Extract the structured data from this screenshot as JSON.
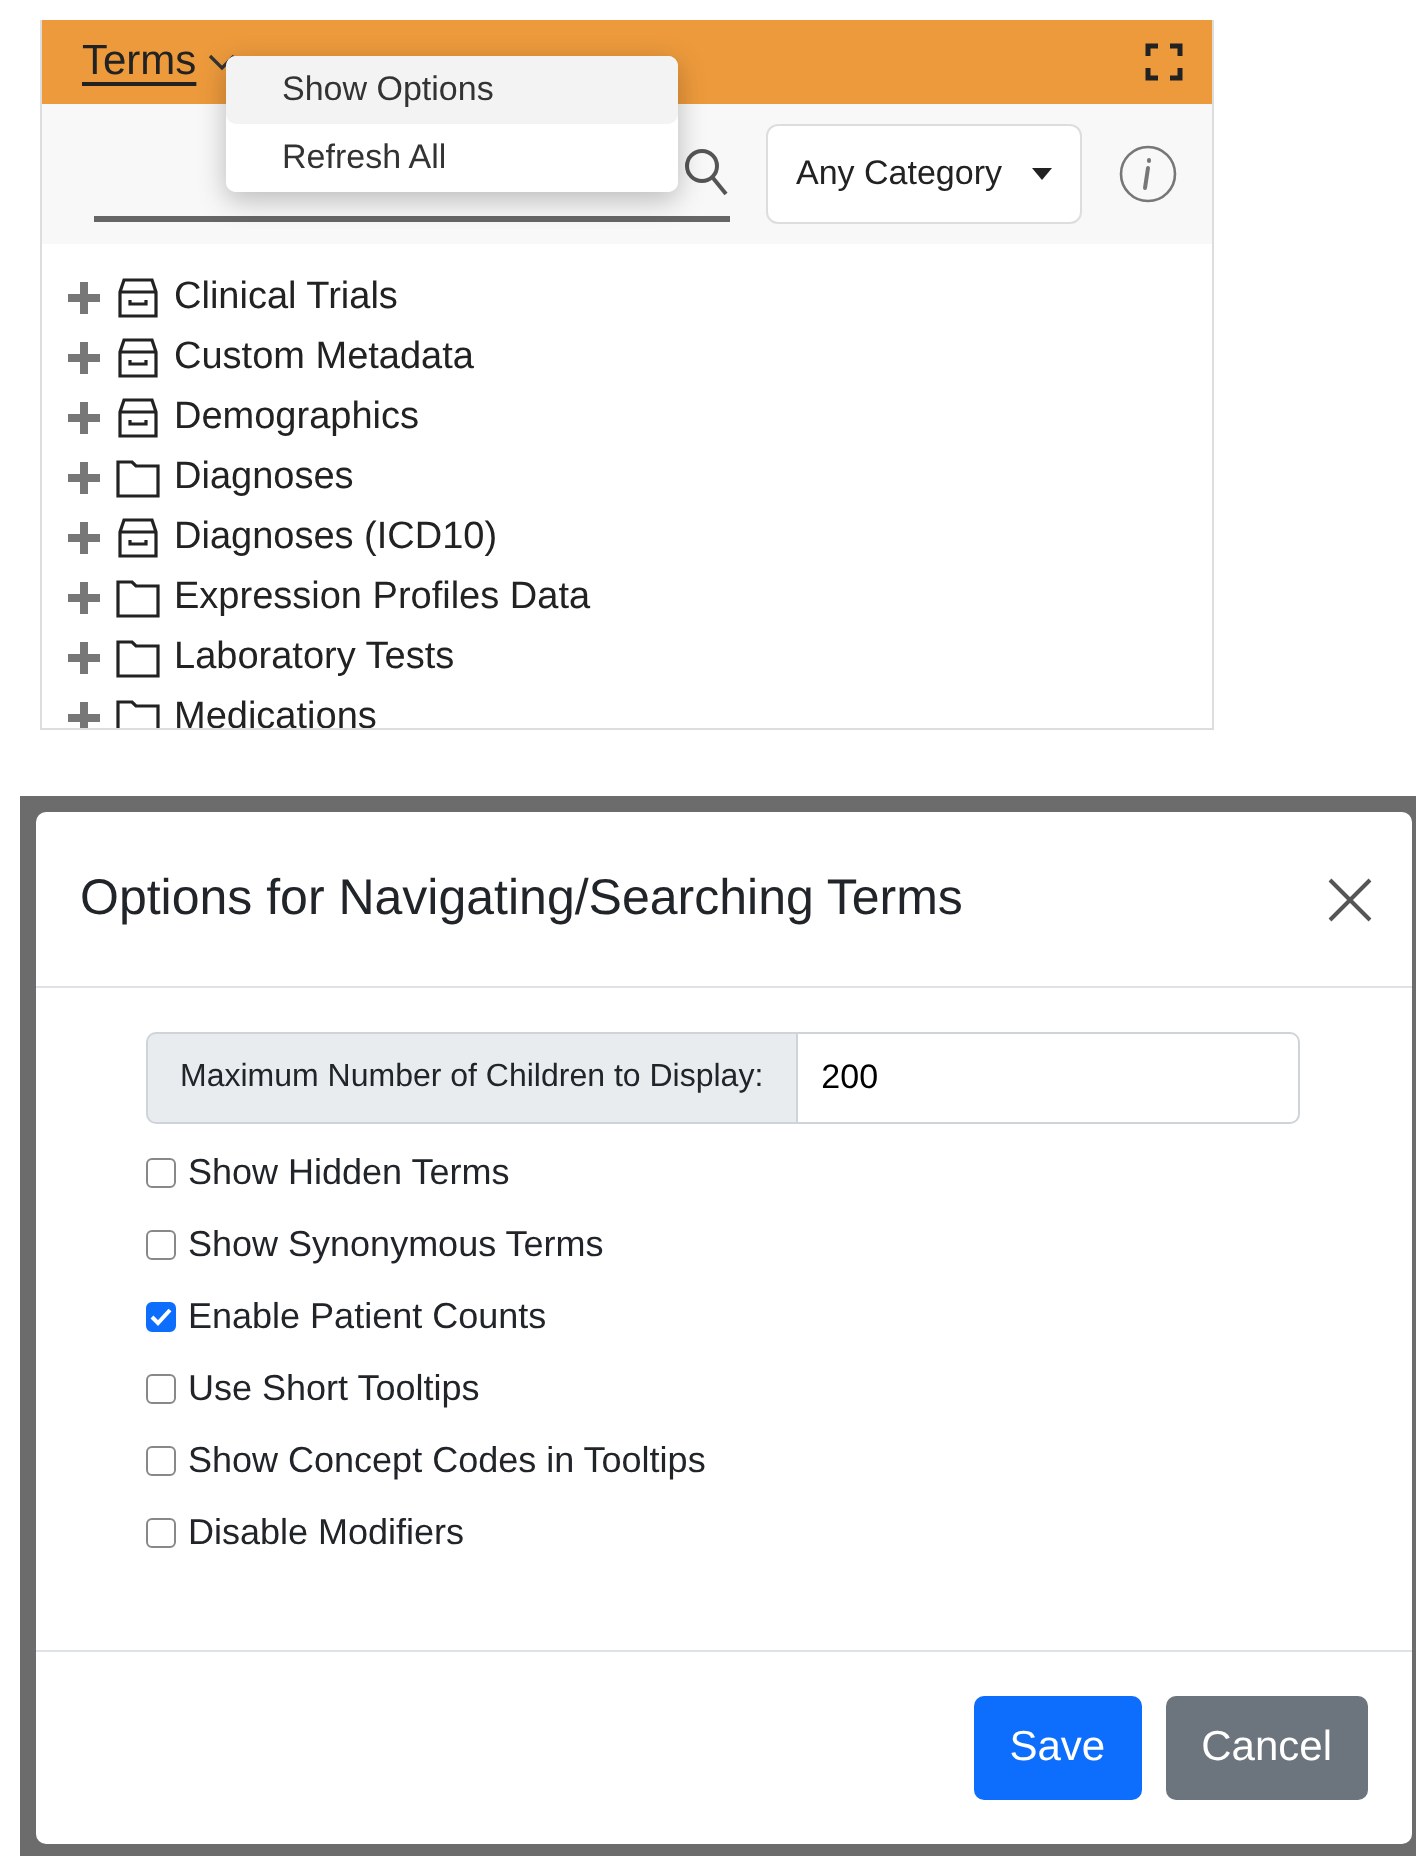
{
  "terms_panel": {
    "title": "Terms",
    "menu": [
      {
        "label": "Show Options",
        "selected": true
      },
      {
        "label": "Refresh All",
        "selected": false
      }
    ],
    "category": "Any Category",
    "tree": [
      {
        "label": "Clinical Trials",
        "kind": "archive"
      },
      {
        "label": "Custom Metadata",
        "kind": "archive"
      },
      {
        "label": "Demographics",
        "kind": "archive"
      },
      {
        "label": "Diagnoses",
        "kind": "folder"
      },
      {
        "label": "Diagnoses (ICD10)",
        "kind": "archive"
      },
      {
        "label": "Expression Profiles Data",
        "kind": "folder"
      },
      {
        "label": "Laboratory Tests",
        "kind": "folder"
      },
      {
        "label": "Medications",
        "kind": "folder"
      }
    ]
  },
  "dialog": {
    "title": "Options for Navigating/Searching Terms",
    "max_children": {
      "label": "Maximum Number of Children to Display:",
      "value": "200"
    },
    "options": [
      {
        "label": "Show Hidden Terms",
        "checked": false
      },
      {
        "label": "Show Synonymous Terms",
        "checked": false
      },
      {
        "label": "Enable Patient Counts",
        "checked": true
      },
      {
        "label": "Use Short Tooltips",
        "checked": false
      },
      {
        "label": "Show Concept Codes in Tooltips",
        "checked": false
      },
      {
        "label": "Disable Modifiers",
        "checked": false
      }
    ],
    "buttons": [
      {
        "label": "Save",
        "kind": "primary"
      },
      {
        "label": "Cancel",
        "kind": "secondary"
      }
    ]
  }
}
